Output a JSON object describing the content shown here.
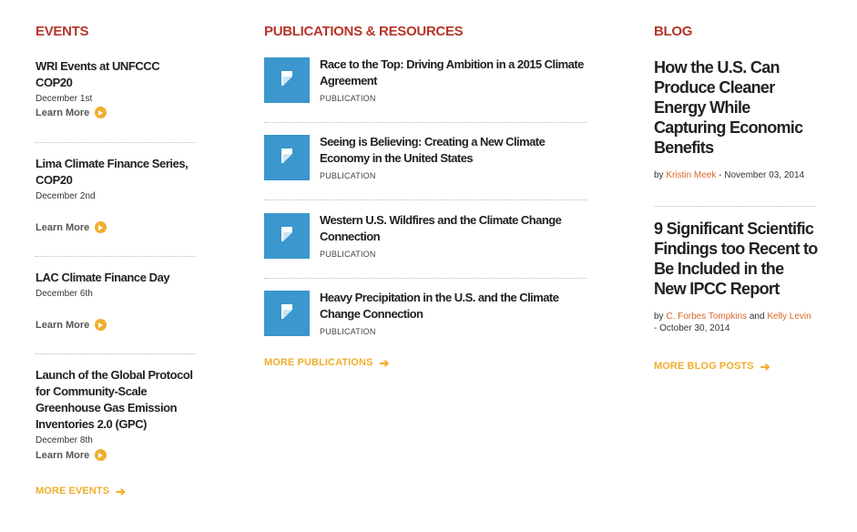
{
  "colors": {
    "section_title": "#b5362a",
    "accent": "#f0ad2e",
    "link": "#d9672a",
    "publication_thumb": "#3b97cd"
  },
  "events": {
    "title": "EVENTS",
    "items": [
      {
        "title": "WRI Events at UNFCCC COP20",
        "date": "December 1st",
        "link_label": "Learn More"
      },
      {
        "title": "Lima Climate Finance Series, COP20",
        "date": "December 2nd",
        "link_label": "Learn More"
      },
      {
        "title": "LAC Climate Finance Day",
        "date": "December 6th",
        "link_label": "Learn More"
      },
      {
        "title": "Launch of the Global Protocol for Community-Scale Greenhouse Gas Emission Inventories 2.0 (GPC)",
        "date": "December 8th",
        "link_label": "Learn More"
      }
    ],
    "more_label": "MORE EVENTS",
    "more_icon": "arrow-right-icon"
  },
  "publications": {
    "title": "PUBLICATIONS & RESOURCES",
    "items": [
      {
        "title": "Race to the Top: Driving Ambition in a 2015 Climate Agreement",
        "type": "PUBLICATION",
        "icon": "document-icon"
      },
      {
        "title": "Seeing is Believing: Creating a New Climate Economy in the United States",
        "type": "PUBLICATION",
        "icon": "document-icon"
      },
      {
        "title": "Western U.S. Wildfires and the Climate Change Connection",
        "type": "PUBLICATION",
        "icon": "document-icon"
      },
      {
        "title": "Heavy Precipitation in the U.S. and the Climate Change Connection",
        "type": "PUBLICATION",
        "icon": "document-icon"
      }
    ],
    "more_label": "MORE PUBLICATIONS",
    "more_icon": "arrow-right-icon"
  },
  "blog": {
    "title": "BLOG",
    "posts": [
      {
        "title": "How the U.S. Can Produce Cleaner Energy While Capturing Economic Benefits",
        "by": "by",
        "author1": "Kristin Meek",
        "date": "- November 03, 2014"
      },
      {
        "title": "9 Significant Scientific Findings too Recent to Be Included in the New IPCC Report",
        "by": "by",
        "author1": "C. Forbes Tompkins",
        "and": "and",
        "author2": "Kelly Levin",
        "date": "- October 30, 2014"
      }
    ],
    "more_label": "MORE BLOG POSTS",
    "more_icon": "arrow-right-icon"
  }
}
